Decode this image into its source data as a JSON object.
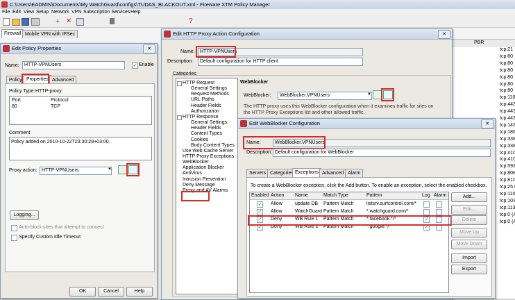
{
  "main": {
    "title": "C:\\Users\\EADMIN\\Documents\\My WatchGuard\\configs\\TUDAS_BLACKOUT.xml - Fireware XTM Policy Manager",
    "menu": [
      "File",
      "Edit",
      "View",
      "Setup",
      "Network",
      "VPN",
      "Subscription Services",
      "Help"
    ],
    "tabs": [
      "Firewall",
      "Mobile VPN with IPSec"
    ],
    "pbr_header": "PBR",
    "right_list": [
      "tcp:21",
      "tcp:80",
      "tcp:80",
      "tcp:80",
      "tcp:80",
      "tcp:80",
      "tcp:80",
      "tcp:110",
      "tcp:443",
      "tcp:443",
      "tcp:443",
      "tcp:1433",
      "tcp:1863",
      "tcp:3389",
      "tcp:3389",
      "tcp:4100",
      "tcp:4105",
      "tcp:5936",
      "tcp:8080",
      "tcp:8100",
      "tcp:25 tcp",
      "tcp:110",
      "tcp:1033",
      "tcp:1130 (",
      "tcp:0 (An",
      "tcp:0 (Ar"
    ]
  },
  "policy": {
    "title": "Edit Policy Properties",
    "name_label": "Name:",
    "name_value": "HTTP-VPNUsers",
    "enable_label": "Enable",
    "tabs": [
      "Policy",
      "Properties",
      "Advanced"
    ],
    "policy_type_label": "Policy Type:",
    "policy_type_value": "HTTP-proxy",
    "port_header": "Port",
    "protocol_header": "Protocol",
    "port_value": "80",
    "protocol_value": "TCP",
    "comment_label": "Comment",
    "comment_value": "Policy added on 2010-10-22T23:30:28+03:00.",
    "proxy_action_label": "Proxy action:",
    "proxy_action_value": "HTTP-VPNUsers",
    "logging_label": "Logging...",
    "autoblock_label": "Auto-block sites that attempt to connect",
    "idle_label": "Specify Custom Idle Timeout",
    "ok_label": "OK",
    "cancel_label": "Cancel",
    "help_label": "Help"
  },
  "proxy": {
    "title": "Edit HTTP Proxy Action Configuration",
    "name_label": "Name:",
    "name_value": "HTTP-VPNUsers",
    "desc_label": "Description:",
    "desc_value": "Default configuration for HTTP client",
    "categories_label": "Categories",
    "tree": [
      {
        "text": "HTTP Request",
        "level": 0
      },
      {
        "text": "General Settings",
        "level": 1
      },
      {
        "text": "Request Methods",
        "level": 1
      },
      {
        "text": "URL Paths",
        "level": 1
      },
      {
        "text": "Header Fields",
        "level": 1
      },
      {
        "text": "Authorization",
        "level": 1
      },
      {
        "text": "HTTP Response",
        "level": 0
      },
      {
        "text": "General Settings",
        "level": 1
      },
      {
        "text": "Header Fields",
        "level": 1
      },
      {
        "text": "Content Types",
        "level": 1
      },
      {
        "text": "Cookies",
        "level": 1
      },
      {
        "text": "Body Content Types",
        "level": 1
      },
      {
        "text": "Use Web Cache Server",
        "level": 0
      },
      {
        "text": "HTTP Proxy Exceptions",
        "level": 0
      },
      {
        "text": "WebBlocker",
        "level": 0
      },
      {
        "text": "Application Blocker",
        "level": 0
      },
      {
        "text": "AntiVirus",
        "level": 0
      },
      {
        "text": "Intrusion Prevention",
        "level": 0
      },
      {
        "text": "Deny Message",
        "level": 0
      },
      {
        "text": "Proxy and AV Alarms",
        "level": 0
      }
    ],
    "section_title": "WebBlocker",
    "wb_label": "WebBlocker:",
    "wb_value": "WebBlocker.VPNUsers",
    "wb_help": "The HTTP proxy uses this WebBlocker configuration when it examines traffic for sites on the HTTP Proxy Exceptions list and other allowed traffic."
  },
  "webblocker": {
    "title": "Edit WebBlocker Configuration",
    "name_label": "Name:",
    "name_value": "WebBlocker.VPNUsers",
    "desc_label": "Description:",
    "desc_value": "Default configuration for WebBlocker",
    "tabs": [
      "Servers",
      "Categories",
      "Exceptions",
      "Advanced",
      "Alarm"
    ],
    "instruction": "To create a WebBlocker exception, click the Add button. To enable an exception, select the enabled checkbox.",
    "columns": [
      "Enabled",
      "Action",
      "Name",
      "Match Type",
      "Pattern",
      "Log",
      "Alarm"
    ],
    "rows": [
      {
        "action": "Allow",
        "name": "update DB",
        "match": "Pattern Match",
        "pattern": "listsrv.surfcontrol.com/*"
      },
      {
        "action": "Allow",
        "name": "WatchGuard",
        "match": "Pattern Match",
        "pattern": "*.watchguard.com/*"
      },
      {
        "action": "Deny",
        "name": "WB Rule 1",
        "match": "Pattern Match",
        "pattern": "*.facebook.*/*"
      },
      {
        "action": "Deny",
        "name": "WB Rule 2",
        "match": "Pattern Match",
        "pattern": "*.google.*/*"
      }
    ],
    "buttons": {
      "add": "Add...",
      "edit": "Edit...",
      "delete": "Delete",
      "up": "Move Up",
      "down": "Move Down",
      "import": "Import",
      "export": "Export"
    }
  }
}
